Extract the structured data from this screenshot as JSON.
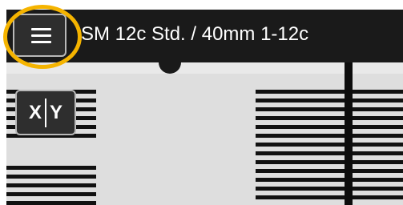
{
  "header": {
    "title": "SM 12c Std. / 40mm 1-12c",
    "menu_icon": "hamburger-menu-icon",
    "highlight_color": "#f5b400"
  },
  "view_toggle": {
    "x_label": "X",
    "y_label": "Y"
  },
  "fiber_view": {
    "stripe_color": "#111111",
    "background_color": "#dedede"
  }
}
